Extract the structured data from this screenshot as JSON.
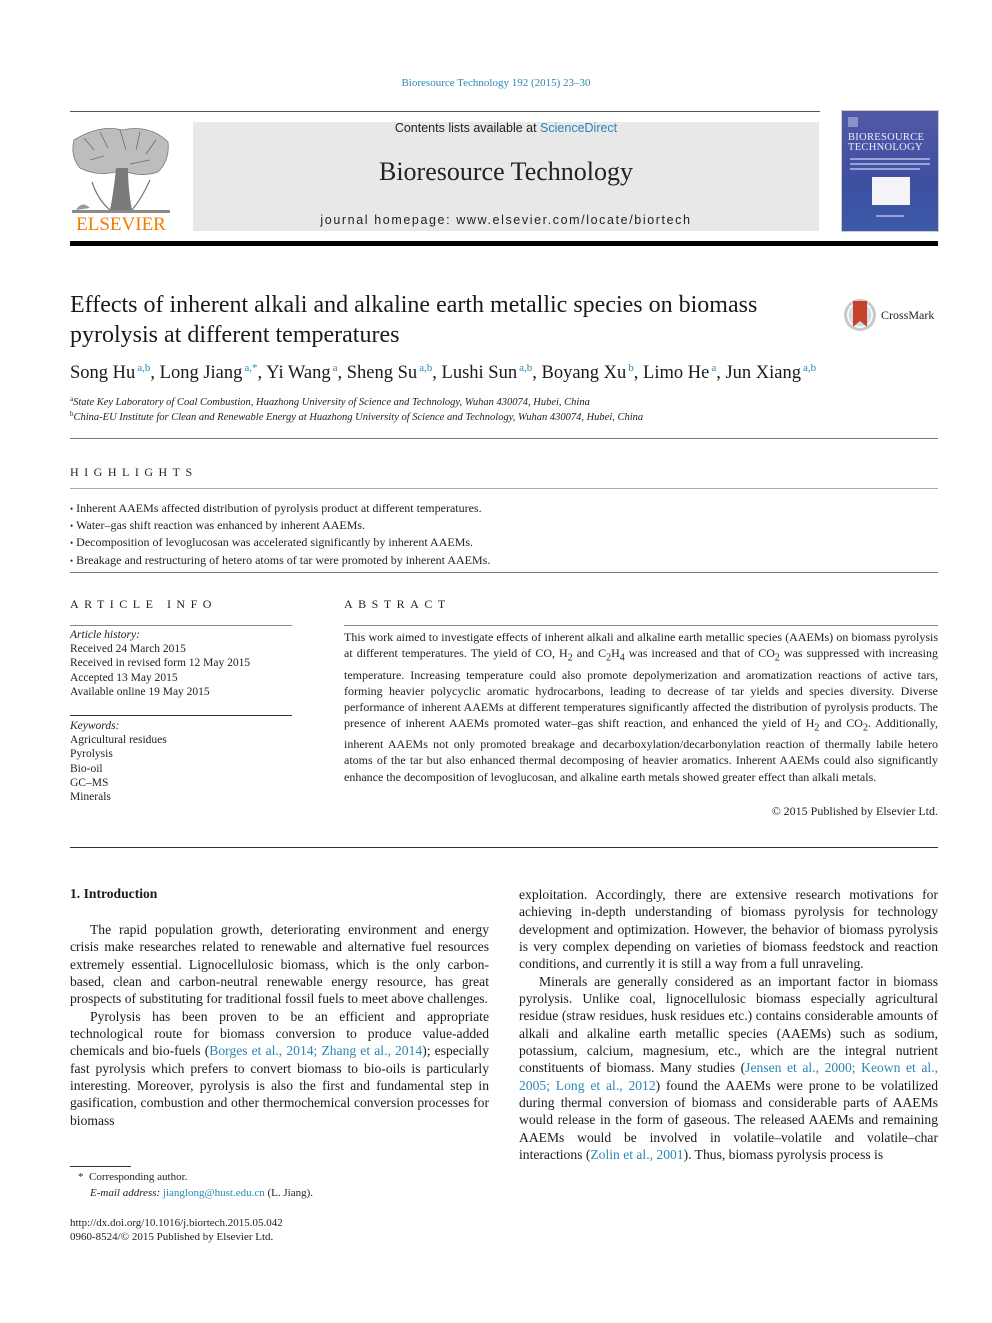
{
  "header": {
    "journal_ref": "Bioresource Technology 192 (2015) 23–30",
    "contents_prefix": "Contents lists available at ",
    "contents_link": "ScienceDirect",
    "journal_title": "Bioresource Technology",
    "homepage_prefix": "journal homepage: ",
    "homepage_url": "www.elsevier.com/locate/biortech",
    "publisher_logo": "ELSEVIER",
    "cover_title_line1": "BIORESOURCE",
    "cover_title_line2": "TECHNOLOGY",
    "crossmark_label": "CrossMark"
  },
  "article": {
    "title": "Effects of inherent alkali and alkaline earth metallic species on biomass pyrolysis at different temperatures",
    "authors": [
      {
        "name": "Song Hu",
        "sup": "a,b",
        "sep": ", "
      },
      {
        "name": "Long Jiang",
        "sup": "a,*",
        "sep": ", "
      },
      {
        "name": "Yi Wang",
        "sup": "a",
        "sep": ", "
      },
      {
        "name": "Sheng Su",
        "sup": "a,b",
        "sep": ", "
      },
      {
        "name": "Lushi Sun",
        "sup": "a,b",
        "sep": ", "
      },
      {
        "name": "Boyang Xu",
        "sup": "b",
        "sep": ", "
      },
      {
        "name": "Limo He",
        "sup": "a",
        "sep": ", "
      },
      {
        "name": "Jun Xiang",
        "sup": "a,b",
        "sep": ""
      }
    ],
    "affiliations": [
      {
        "mark": "a",
        "text": "State Key Laboratory of Coal Combustion, Huazhong University of Science and Technology, Wuhan 430074, Hubei, China"
      },
      {
        "mark": "b",
        "text": "China-EU Institute for Clean and Renewable Energy at Huazhong University of Science and Technology, Wuhan 430074, Hubei, China"
      }
    ]
  },
  "highlights": {
    "label": "HIGHLIGHTS",
    "items": [
      "Inherent AAEMs affected distribution of pyrolysis product at different temperatures.",
      "Water–gas shift reaction was enhanced by inherent AAEMs.",
      "Decomposition of levoglucosan was accelerated significantly by inherent AAEMs.",
      "Breakage and restructuring of hetero atoms of tar were promoted by inherent AAEMs."
    ]
  },
  "article_info": {
    "label": "ARTICLE INFO",
    "history_label": "Article history:",
    "history": [
      "Received 24 March 2015",
      "Received in revised form 12 May 2015",
      "Accepted 13 May 2015",
      "Available online 19 May 2015"
    ],
    "keywords_label": "Keywords:",
    "keywords": [
      "Agricultural residues",
      "Pyrolysis",
      "Bio-oil",
      "GC–MS",
      "Minerals"
    ]
  },
  "abstract": {
    "label": "ABSTRACT",
    "part1": "This work aimed to investigate effects of inherent alkali and alkaline earth metallic species (AAEMs) on biomass pyrolysis at different temperatures. The yield of CO, H",
    "part2": " and C",
    "part3": "H",
    "part4": " was increased and that of CO",
    "part5": " was suppressed with increasing temperature. Increasing temperature could also promote depolymerization and aromatization reactions of active tars, forming heavier polycyclic aromatic hydrocarbons, leading to decrease of tar yields and species diversity. Diverse performance of inherent AAEMs at different temperatures significantly affected the distribution of pyrolysis products. The presence of inherent AAEMs promoted water–gas shift reaction, and enhanced the yield of H",
    "part6": " and CO",
    "part7": ". Additionally, inherent AAEMs not only promoted breakage and decarboxylation/decarbonylation reaction of thermally labile hetero atoms of the tar but also enhanced thermal decomposing of heavier aromatics. Inherent AAEMs could also significantly enhance the decomposition of levoglucosan, and alkaline earth metals showed greater effect than alkali metals.",
    "sub2": "2",
    "sub4": "4",
    "copyright": "© 2015 Published by Elsevier Ltd."
  },
  "body": {
    "section_heading": "1. Introduction",
    "left_p1": "The rapid population growth, deteriorating environment and energy crisis make researches related to renewable and alternative fuel resources extremely essential. Lignocellulosic biomass, which is the only carbon-based, clean and carbon-neutral renewable energy resource, has great prospects of substituting for traditional fossil fuels to meet above challenges.",
    "left_p2_a": "Pyrolysis has been proven to be an efficient and appropriate technological route for biomass conversion to produce value-added chemicals and bio-fuels (",
    "left_p2_cite": "Borges et al., 2014; Zhang et al., 2014",
    "left_p2_b": "); especially fast pyrolysis which prefers to convert biomass to bio-oils is particularly interesting. Moreover, pyrolysis is also the first and fundamental step in gasification, combustion and other thermochemical conversion processes for biomass",
    "right_p1": "exploitation. Accordingly, there are extensive research motivations for achieving in-depth understanding of biomass pyrolysis for technology development and optimization. However, the behavior of biomass pyrolysis is very complex depending on varieties of biomass feedstock and reaction conditions, and currently it is still a way from a full unraveling.",
    "right_p2_a": "Minerals are generally considered as an important factor in biomass pyrolysis. Unlike coal, lignocellulosic biomass especially agricultural residue (straw residues, husk residues etc.) contains considerable amounts of alkali and alkaline earth metallic species (AAEMs) such as sodium, potassium, calcium, magnesium, etc., which are the integral nutrient constituents of biomass. Many studies (",
    "right_p2_cite1": "Jensen et al., 2000; Keown et al., 2005; Long et al., 2012",
    "right_p2_b": ") found the AAEMs were prone to be volatilized during thermal conversion of biomass and considerable parts of AAEMs would release in the form of gaseous. The released AAEMs and remaining AAEMs would be involved in volatile–volatile and volatile–char interactions (",
    "right_p2_cite2": "Zolin et al., 2001",
    "right_p2_c": "). Thus, biomass pyrolysis process is"
  },
  "footnotes": {
    "star": "*",
    "corresponding": "Corresponding author.",
    "email_label": "E-mail address:",
    "email": "jianglong@hust.edu.cn",
    "email_suffix": " (L. Jiang).",
    "doi": "http://dx.doi.org/10.1016/j.biortech.2015.05.042",
    "issn": "0960-8524/© 2015 Published by Elsevier Ltd."
  },
  "colors": {
    "link": "#2a87b3",
    "elsevier_orange": "#f07c00",
    "band_gray": "#e8e8e8",
    "cover_blue": "#4552a3"
  }
}
